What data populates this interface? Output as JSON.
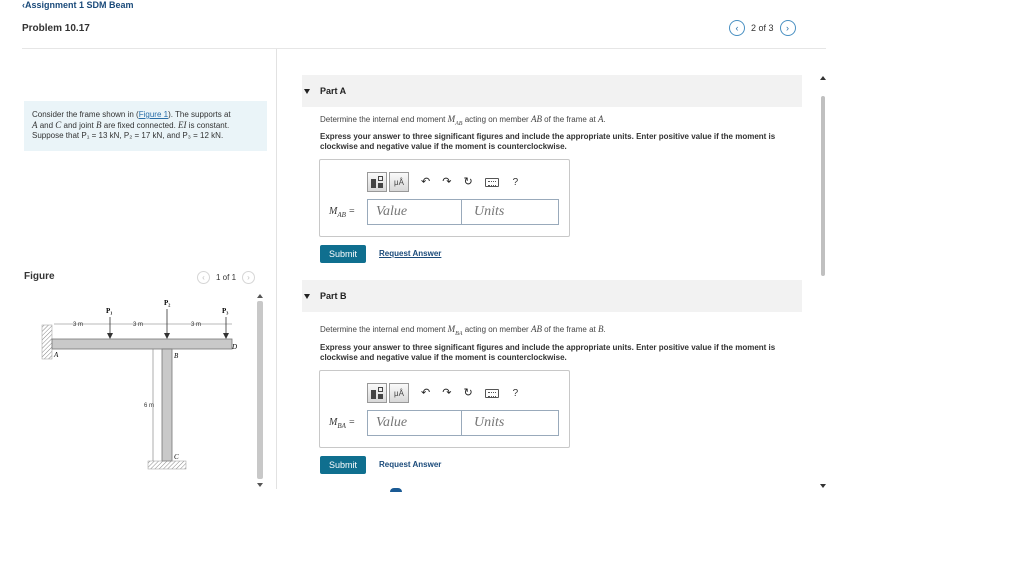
{
  "nav": {
    "back_label": "Assignment 1 SDM Beam",
    "problem_title": "Problem 10.17",
    "pager": "2 of 3"
  },
  "problem": {
    "text_1": "Consider the frame shown in (",
    "figure_link": "Figure 1",
    "text_2": "). The supports at",
    "line2_a": "A",
    "line2_b": " and ",
    "line2_c": "C",
    "line2_d": " and joint ",
    "line2_e": "B",
    "line2_f": " are fixed connected. ",
    "line2_g": "EI",
    "line2_h": " is constant.",
    "line3": "Suppose that P₁ = 13 kN, P₂ = 17 kN, and P₃ = 12 kN."
  },
  "figure": {
    "label": "Figure",
    "pager": "1 of 1",
    "labels": {
      "p1": "P₁",
      "p2": "P₂",
      "p3": "P₃",
      "dim1": "3 m",
      "dim2": "3 m",
      "dim3": "3 m",
      "dim_v": "6 m",
      "a": "A",
      "b": "B",
      "c": "C",
      "d": "D"
    }
  },
  "part_a": {
    "title": "Part A",
    "q_1": "Determine the internal end moment ",
    "q_var": "M",
    "q_sub": "AB",
    "q_2": " acting on member ",
    "q_member": "AB",
    "q_3": " of the frame at ",
    "q_point": "A",
    "q_4": ".",
    "instructions": "Express your answer to three significant figures and include the appropriate units. Enter positive value if the moment is clockwise and negative value if the moment is counterclockwise.",
    "var_label": "M",
    "var_sub": "AB",
    "eq": " =",
    "value_placeholder": "Value",
    "units_placeholder": "Units",
    "submit": "Submit",
    "request": "Request Answer"
  },
  "part_b": {
    "title": "Part B",
    "q_1": "Determine the internal end moment ",
    "q_var": "M",
    "q_sub": "BA",
    "q_2": " acting on member ",
    "q_member": "AB",
    "q_3": " of the frame at ",
    "q_point": "B",
    "q_4": ".",
    "instructions": "Express your answer to three significant figures and include the appropriate units. Enter positive value if the moment is clockwise and negative value if the moment is counterclockwise.",
    "var_label": "M",
    "var_sub": "BA",
    "eq": " =",
    "value_placeholder": "Value",
    "units_placeholder": "Units",
    "submit": "Submit",
    "request": "Request Answer"
  },
  "toolbar": {
    "units_btn": "μÅ",
    "help": "?",
    "icons": [
      "template-icon",
      "units-icon",
      "undo-icon",
      "redo-icon",
      "reset-icon",
      "keyboard-icon",
      "help-icon"
    ]
  }
}
